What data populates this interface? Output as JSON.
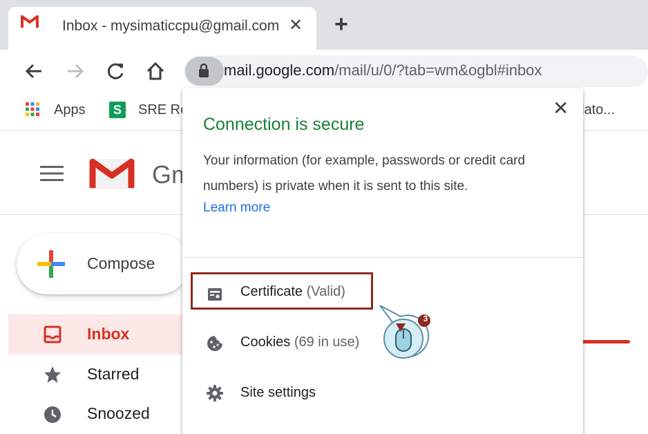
{
  "tab": {
    "title": "Inbox - mysimaticcpu@gmail.com",
    "close_glyph": "✕",
    "newtab_glyph": "+",
    "favicon": "gmail-m-icon"
  },
  "toolbar": {
    "back_icon": "arrow-left-icon",
    "forward_icon": "arrow-right-icon",
    "reload_icon": "reload-icon",
    "home_icon": "home-icon",
    "url_host": "mail.google.com",
    "url_path": "/mail/u/0/?tab=wm&ogbl#inbox"
  },
  "bookmarks": {
    "apps_label": "Apps",
    "sre_label": "SRE Re",
    "sre_icon_letter": "S",
    "translate_label": "nslato..."
  },
  "gmail": {
    "wordmark": "Gm",
    "compose_label": "Compose",
    "nav": [
      {
        "label": "Inbox",
        "icon": "inbox-icon"
      },
      {
        "label": "Starred",
        "icon": "star-icon"
      },
      {
        "label": "Snoozed",
        "icon": "clock-icon"
      }
    ]
  },
  "popup": {
    "close_glyph": "✕",
    "title": "Connection is secure",
    "description": "Your information (for example, passwords or credit card numbers) is private when it is sent to this site.",
    "learn_more": "Learn more",
    "items": [
      {
        "label": "Certificate",
        "sub": "(Valid)",
        "icon": "certificate-icon"
      },
      {
        "label": "Cookies",
        "sub": "(69 in use)",
        "icon": "cookie-icon"
      },
      {
        "label": "Site settings",
        "sub": "",
        "icon": "gear-icon"
      }
    ]
  },
  "callout": {
    "step_number": "3"
  },
  "colors": {
    "secure_green": "#188038",
    "link_blue": "#1a73e8",
    "gmail_red": "#d93025",
    "highlight_border": "#8b2a1f"
  }
}
